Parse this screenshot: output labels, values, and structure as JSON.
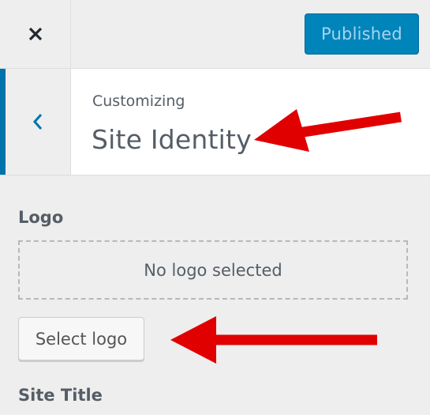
{
  "header": {
    "close_icon": "close-icon",
    "publish_label": "Published",
    "publish_color": "#0085ba"
  },
  "section": {
    "back_icon": "chevron-left-icon",
    "breadcrumb": "Customizing",
    "title": "Site Identity",
    "accent_color": "#0073aa"
  },
  "logo": {
    "label": "Logo",
    "placeholder": "No logo selected",
    "select_button_label": "Select logo"
  },
  "site_title": {
    "label": "Site Title"
  },
  "annotations": {
    "arrow_color": "#e00000"
  }
}
